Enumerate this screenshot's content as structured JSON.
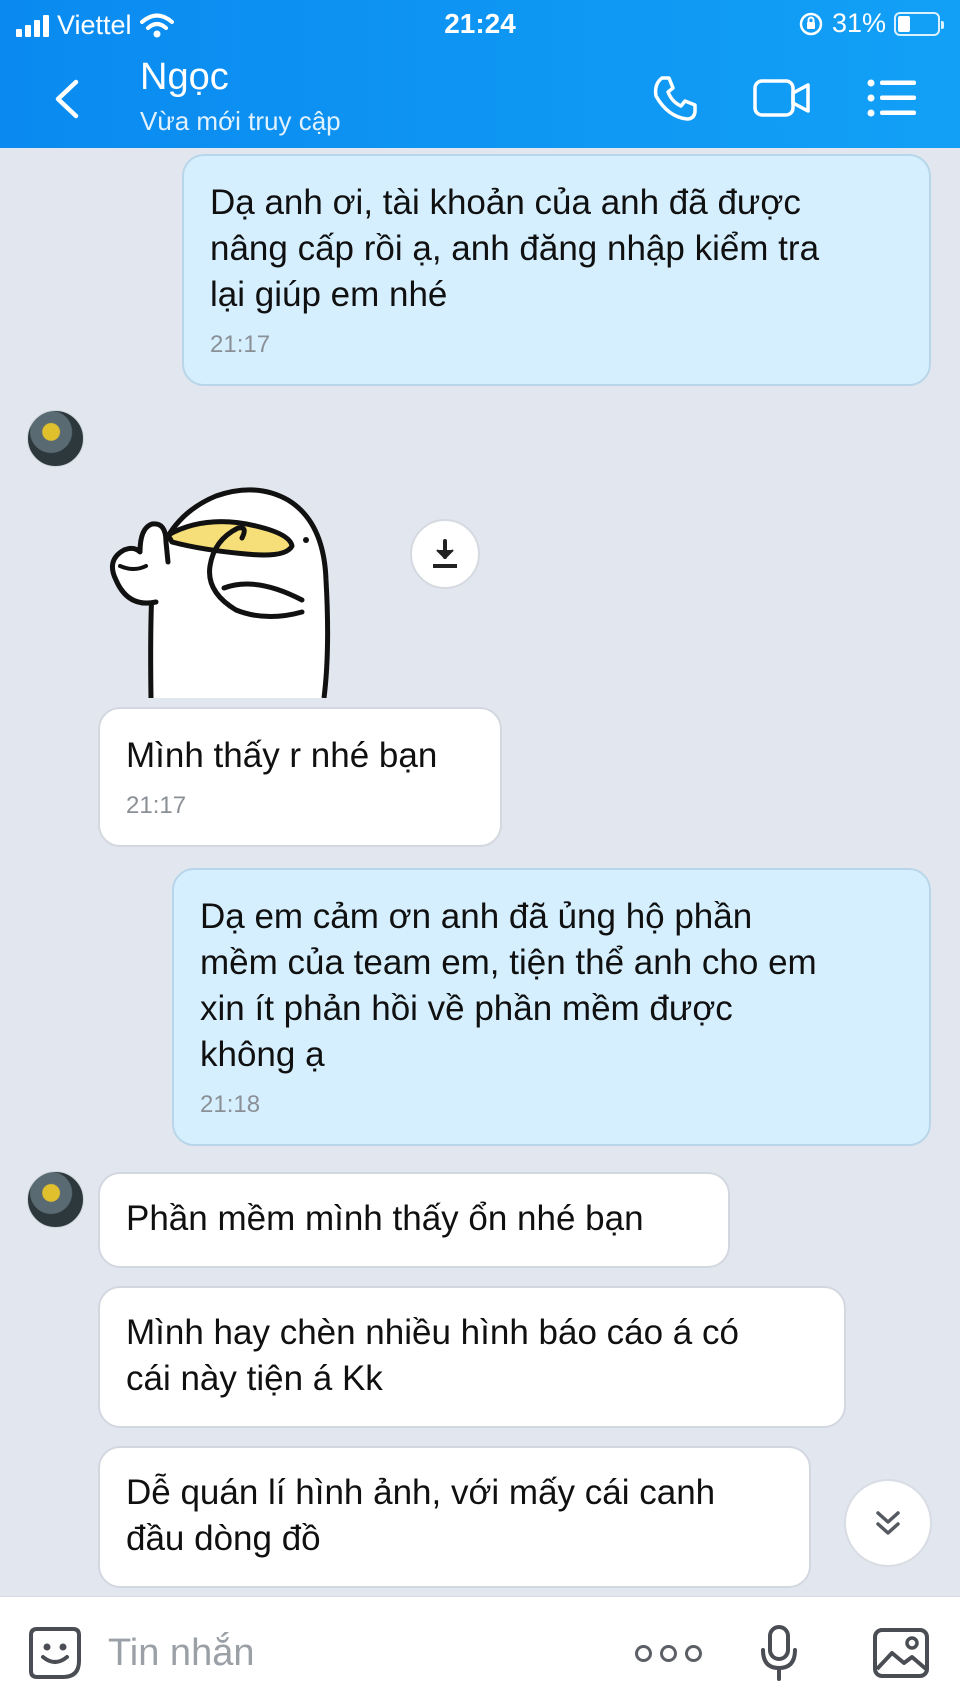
{
  "status_bar": {
    "carrier": "Viettel",
    "time": "21:24",
    "battery": "31%",
    "battery_level": 0.31
  },
  "header": {
    "contact_name": "Ngọc",
    "contact_status": "Vừa mới truy cập"
  },
  "messages": [
    {
      "direction": "outgoing",
      "text": "Dạ anh ơi, tài khoản của anh đã được\nnâng cấp rồi ạ, anh đăng nhập kiểm tra\nlại giúp em nhé",
      "time": "21:17"
    },
    {
      "direction": "incoming",
      "type": "sticker"
    },
    {
      "direction": "incoming",
      "text": "Mình thấy r nhé bạn",
      "time": "21:17"
    },
    {
      "direction": "outgoing",
      "text": "Dạ em cảm ơn anh đã ủng hộ phần\nmềm của team em, tiện thể anh cho em\nxin ít phản hồi về phần mềm được\nkhông ạ",
      "time": "21:18"
    },
    {
      "direction": "incoming",
      "text": "Phần mềm mình thấy ổn nhé bạn"
    },
    {
      "direction": "incoming",
      "text": "Mình hay chèn nhiều hình báo cáo á có\ncái này tiện á Kk"
    },
    {
      "direction": "incoming",
      "text": "Dễ quán lí hình ảnh, với mấy cái canh\nđầu dòng đồ"
    }
  ],
  "composer": {
    "placeholder": "Tin nhắn"
  },
  "icons": {
    "back": "chevron-left-icon",
    "call": "phone-icon",
    "video": "video-camera-icon",
    "menu": "menu-list-icon",
    "download": "download-icon",
    "scroll_down": "double-chevron-down-icon",
    "emoji": "sticker-face-icon",
    "more": "more-dots-icon",
    "mic": "microphone-icon",
    "gallery": "image-icon"
  },
  "colors": {
    "header": "#0a8af0",
    "outgoing_bubble": "#d5efff",
    "incoming_bubble": "#ffffff",
    "background": "#e2e6ef"
  }
}
